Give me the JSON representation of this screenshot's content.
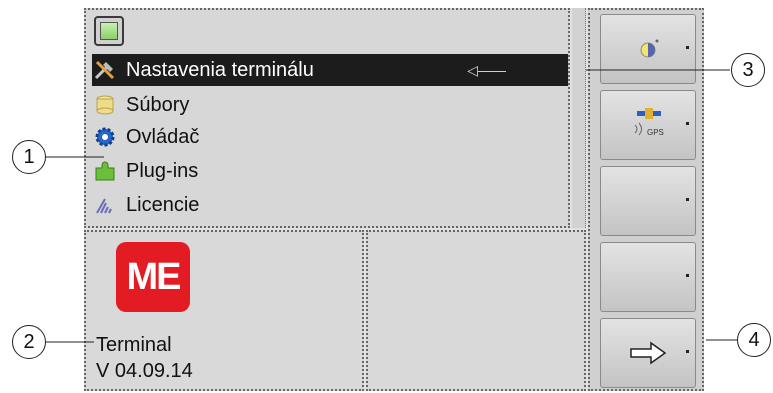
{
  "menu": {
    "header_icon": "terminal-screen-icon",
    "items": [
      {
        "label": "Nastavenia terminálu",
        "icon": "tools-icon",
        "selected": true
      },
      {
        "label": "Súbory",
        "icon": "files-icon",
        "selected": false
      },
      {
        "label": "Ovládač",
        "icon": "gear-icon",
        "selected": false
      },
      {
        "label": "Plug-ins",
        "icon": "puzzle-icon",
        "selected": false
      },
      {
        "label": "Licencie",
        "icon": "license-icon",
        "selected": false
      }
    ]
  },
  "info": {
    "logo_text": "ME",
    "name": "Terminal",
    "version": "V 04.09.14"
  },
  "softkeys": [
    {
      "icon": "brightness-icon"
    },
    {
      "icon": "gps-satellite-icon",
      "text": "GPS"
    },
    {
      "icon": ""
    },
    {
      "icon": ""
    },
    {
      "icon": "arrow-right-icon"
    }
  ],
  "callouts": [
    "1",
    "2",
    "3",
    "4"
  ],
  "colors": {
    "selected_bg": "#1c1c1c",
    "logo_red": "#e31c24",
    "panel_bg": "#d7d7d7"
  }
}
